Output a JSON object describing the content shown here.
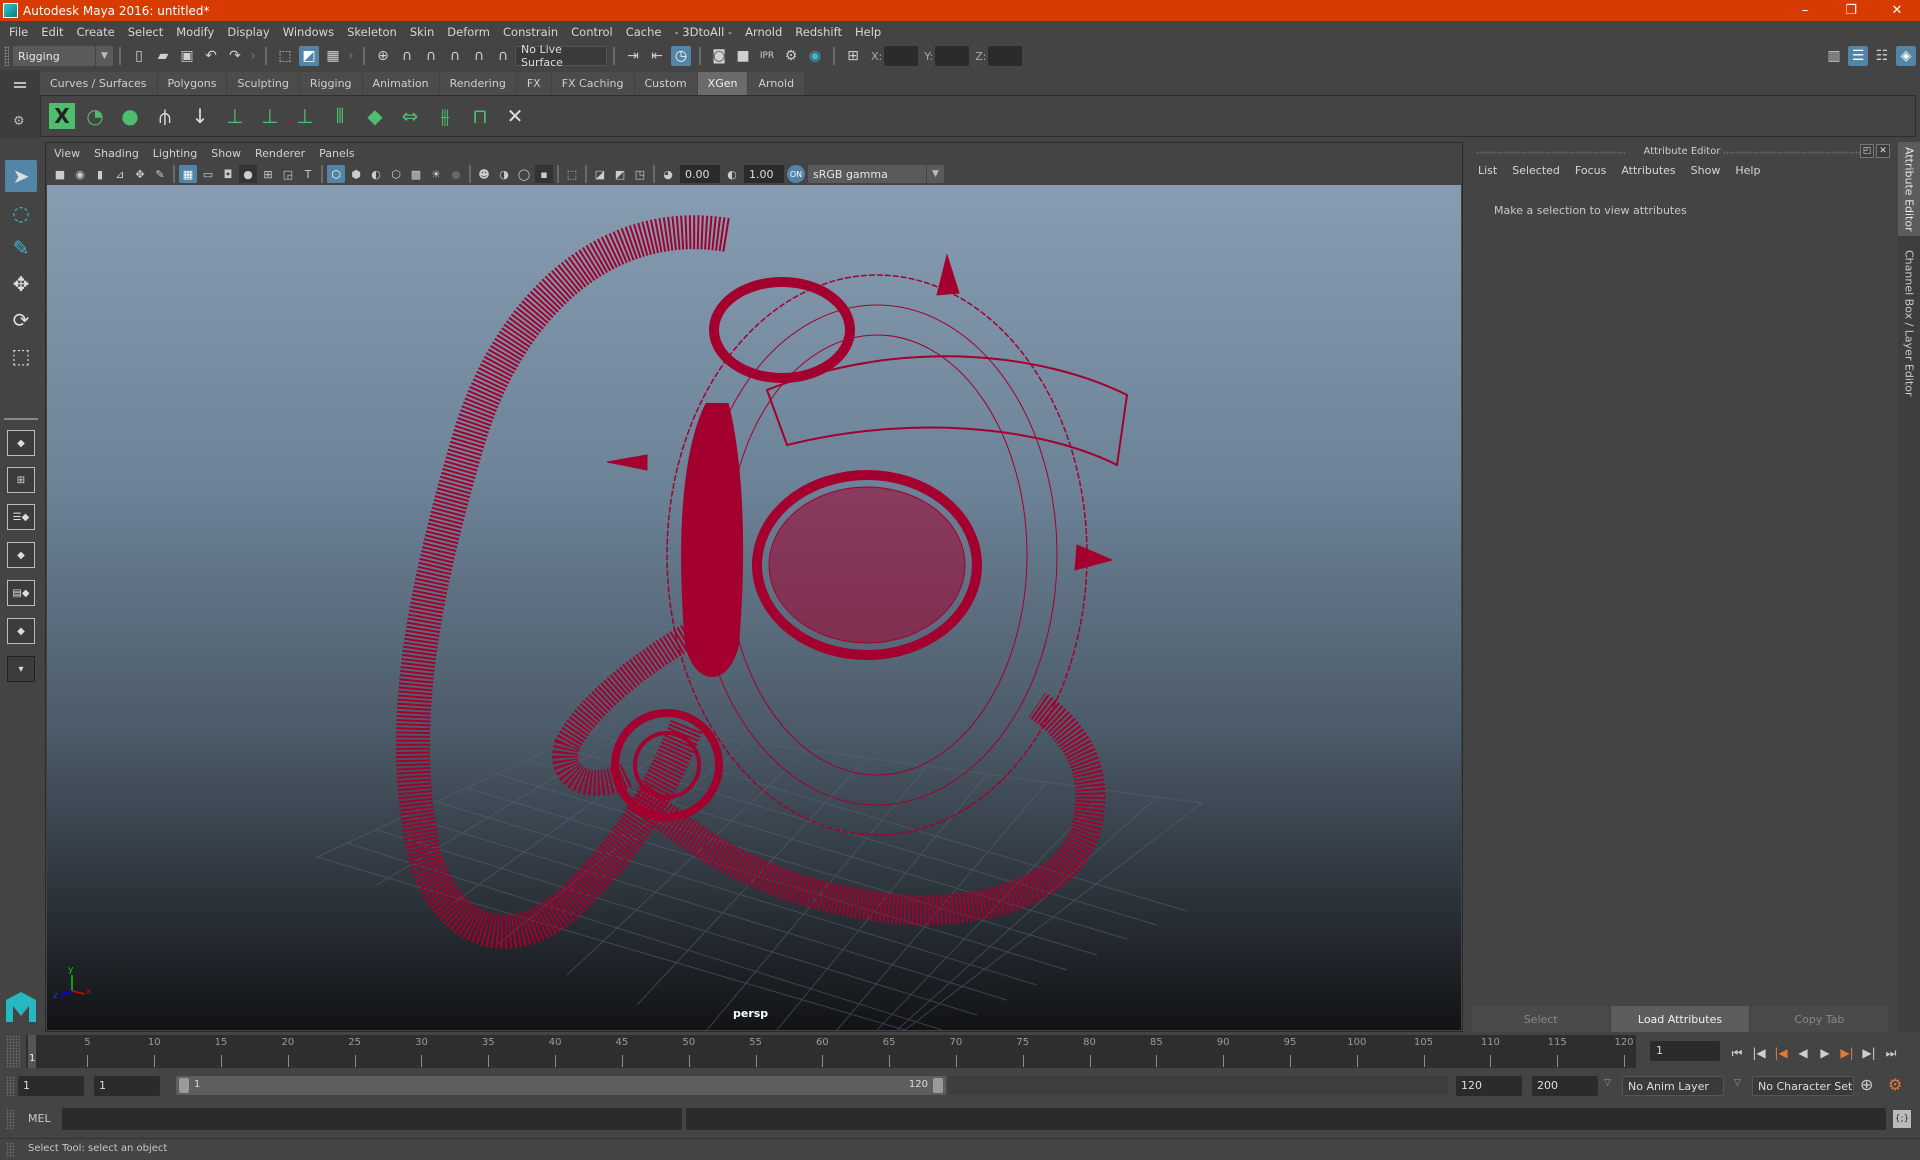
{
  "window": {
    "title": "Autodesk Maya 2016: untitled*",
    "controls": [
      "minimize",
      "restore",
      "close"
    ],
    "accent_color": "#d83b01"
  },
  "menubar": {
    "items": [
      "File",
      "Edit",
      "Create",
      "Select",
      "Modify",
      "Display",
      "Windows",
      "Skeleton",
      "Skin",
      "Deform",
      "Constrain",
      "Control",
      "Cache",
      "- 3DtoAll -",
      "Arnold",
      "Redshift",
      "Help"
    ]
  },
  "toolbar": {
    "workspace": "Rigging",
    "live_surface": "No Live Surface",
    "coord_labels": {
      "x": "X:",
      "y": "Y:",
      "z": "Z:"
    },
    "coord_values": {
      "x": "",
      "y": "",
      "z": ""
    }
  },
  "shelf": {
    "tabs": [
      "Curves / Surfaces",
      "Polygons",
      "Sculpting",
      "Rigging",
      "Animation",
      "Rendering",
      "FX",
      "FX Caching",
      "Custom",
      "XGen",
      "Arnold"
    ],
    "active_tab": "XGen",
    "icons": [
      "xgen-editor-icon",
      "xgen-preview-icon",
      "xgen-clear-icon",
      "add-guide-icon",
      "place-guide-icon",
      "add-guide-plus-icon",
      "guide-origin-icon",
      "lock-guide-icon",
      "guide-bend-icon",
      "guide-grid-icon",
      "guide-length-icon",
      "select-guide-icon",
      "guide-select-frame-icon",
      "delete-guide-icon"
    ]
  },
  "viewport": {
    "menu": [
      "View",
      "Shading",
      "Lighting",
      "Show",
      "Renderer",
      "Panels"
    ],
    "exposure": "0.00",
    "gamma": "1.00",
    "color_space": "sRGB gamma",
    "camera_label": "persp",
    "axis": {
      "x": "x",
      "y": "y",
      "z": "z"
    },
    "wireframe_color": "#a3002f"
  },
  "attribute_editor": {
    "title": "Attribute Editor",
    "menu": [
      "List",
      "Selected",
      "Focus",
      "Attributes",
      "Show",
      "Help"
    ],
    "message": "Make a selection to view attributes",
    "buttons": {
      "select": "Select",
      "load": "Load Attributes",
      "copy": "Copy Tab"
    }
  },
  "side_tabs": [
    "Attribute Editor",
    "Channel Box / Layer Editor"
  ],
  "timeline": {
    "current_frame_marker": "1",
    "ticks": [
      5,
      10,
      15,
      20,
      25,
      30,
      35,
      40,
      45,
      50,
      55,
      60,
      65,
      70,
      75,
      80,
      85,
      90,
      95,
      100,
      105,
      110,
      115,
      120
    ],
    "min": 1,
    "max": 120,
    "current_frame": "1"
  },
  "range": {
    "start_time": "1",
    "playback_start": "1",
    "slider_start": "1",
    "slider_end": "120",
    "playback_end": "120",
    "end_time": "200",
    "anim_layer": "No Anim Layer",
    "character_set": "No Character Set"
  },
  "command_line": {
    "label": "MEL",
    "value": "",
    "result": ""
  },
  "status": {
    "help_line": "Select Tool: select an object"
  }
}
